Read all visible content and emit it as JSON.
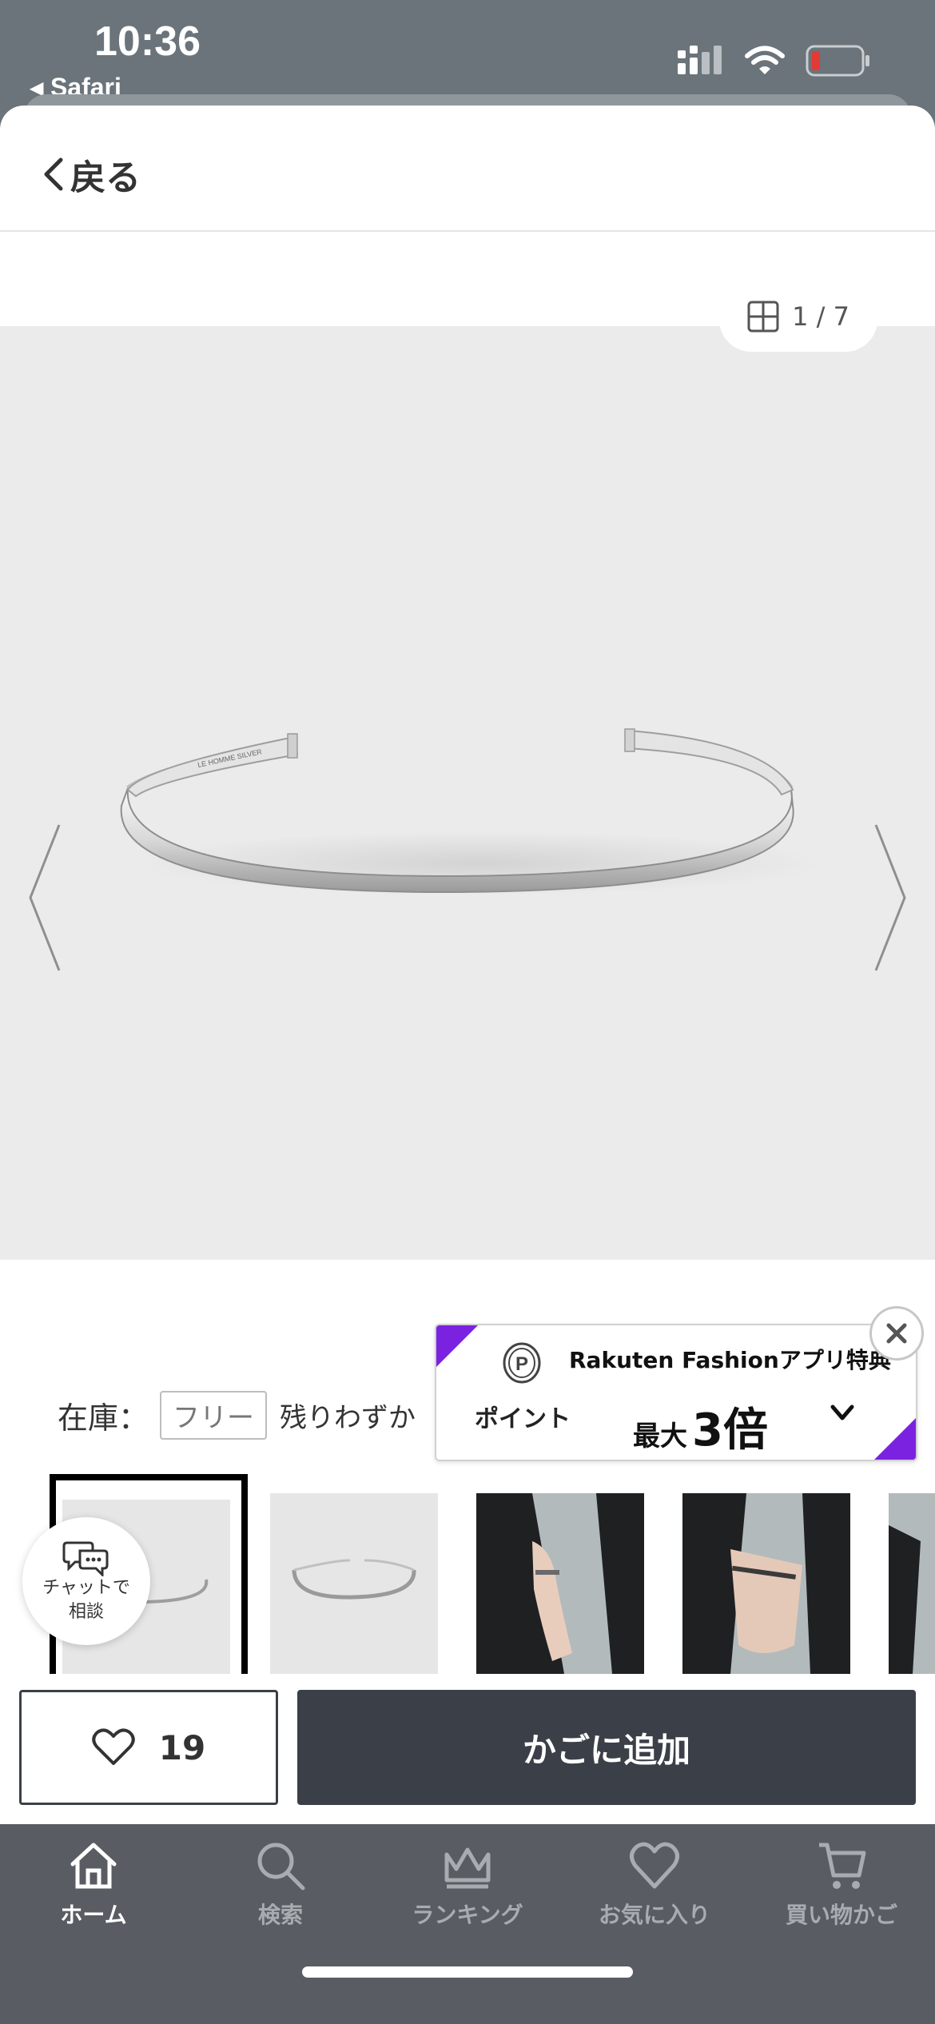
{
  "status_bar": {
    "time": "10:36",
    "back_app": "◂ Safari",
    "battery_color": "#e53935"
  },
  "header": {
    "back_label": "戻る"
  },
  "gallery": {
    "counter": "1 / 7",
    "current": 1,
    "total": 7,
    "engraving": "LE HOMME  SILVER"
  },
  "stock": {
    "label": "在庫：",
    "size": "フリー",
    "status": "残りわずか"
  },
  "promo": {
    "icon": "point-coin-icon",
    "point_label": "ポイント",
    "title": "Rakuten Fashionアプリ特典",
    "max_prefix": "最大",
    "max_value": "3倍",
    "accent_color": "#7b22e0"
  },
  "chat": {
    "label_line1": "チャットで",
    "label_line2": "相談"
  },
  "actions": {
    "favorite_count": "19",
    "add_to_cart": "かごに追加"
  },
  "tabbar": {
    "items": [
      {
        "label": "ホーム",
        "icon": "home-icon",
        "active": true
      },
      {
        "label": "検索",
        "icon": "search-icon",
        "active": false
      },
      {
        "label": "ランキング",
        "icon": "crown-icon",
        "active": false
      },
      {
        "label": "お気に入り",
        "icon": "heart-icon",
        "active": false
      },
      {
        "label": "買い物かご",
        "icon": "cart-icon",
        "active": false
      }
    ]
  }
}
